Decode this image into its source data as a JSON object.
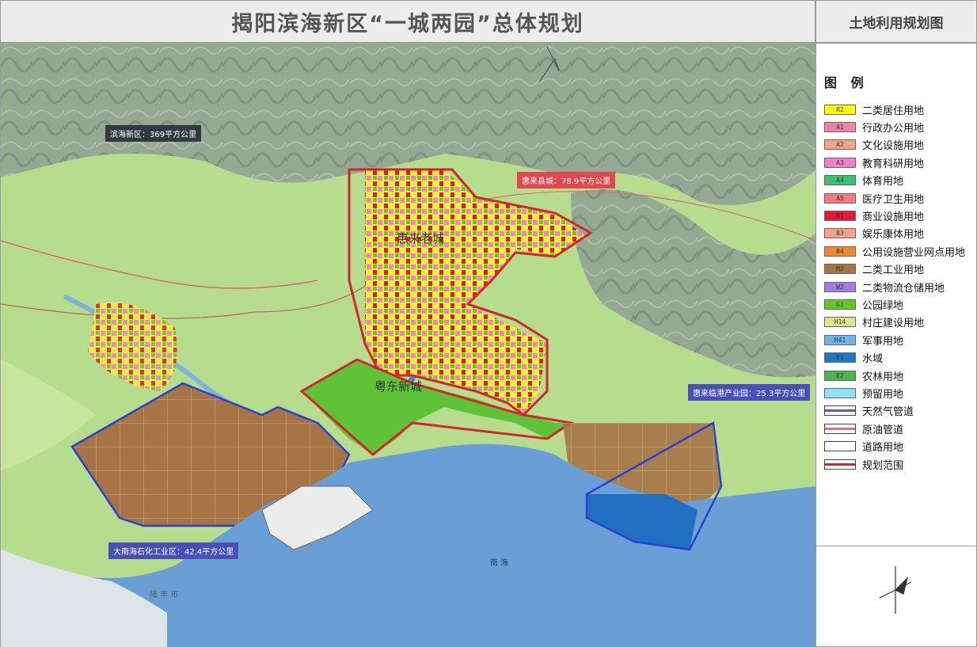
{
  "header": {
    "title": "揭阳滨海新区“一城两园”总体规划",
    "side_title": "土地利用规划图"
  },
  "map": {
    "labels": {
      "binhai": "滨海新区：369平方公里",
      "huilai_county": "惠来县城：78.9平方公里",
      "huilai_port": "惠来临港产业园：25.3平方公里",
      "dananhai": "大南海石化工业区：42.4平方公里"
    },
    "places": {
      "old_city": "惠来老城",
      "new_city": "粤东新城",
      "south_sea": "南 海",
      "lufeng": "陆 丰 市"
    },
    "colors": {
      "sea": "#6a9fd6",
      "forest": "#8ea48d",
      "farmland": "#a9d77c",
      "residential": "#ffff3a",
      "industrial": "#a67445",
      "boundary": "#d3262b"
    }
  },
  "legend": {
    "title": "图 例",
    "items": [
      {
        "code": "R2",
        "label": "二类居住用地",
        "color": "#ffff00"
      },
      {
        "code": "A1",
        "label": "行政办公用地",
        "color": "#ee82a8"
      },
      {
        "code": "A2",
        "label": "文化设施用地",
        "color": "#f7a38a"
      },
      {
        "code": "A3",
        "label": "教育科研用地",
        "color": "#f07fd0"
      },
      {
        "code": "A4",
        "label": "体育用地",
        "color": "#36c36a"
      },
      {
        "code": "A5",
        "label": "医疗卫生用地",
        "color": "#f57a7f"
      },
      {
        "code": "B1",
        "label": "商业设施用地",
        "color": "#e8163c"
      },
      {
        "code": "B3",
        "label": "娱乐康体用地",
        "color": "#f7a08a"
      },
      {
        "code": "B4",
        "label": "公用设施营业网点用地",
        "color": "#f0882f"
      },
      {
        "code": "M2",
        "label": "二类工业用地",
        "color": "#a67445"
      },
      {
        "code": "W2",
        "label": "二类物流仓储用地",
        "color": "#a07be8"
      },
      {
        "code": "G1",
        "label": "公园绿地",
        "color": "#66c81f"
      },
      {
        "code": "H14",
        "label": "村庄建设用地",
        "color": "#e0e28a"
      },
      {
        "code": "H41",
        "label": "军事用地",
        "color": "#6ab6ec"
      },
      {
        "code": "E1",
        "label": "水域",
        "color": "#1f79c8"
      },
      {
        "code": "E2",
        "label": "农林用地",
        "color": "#4cb54a"
      },
      {
        "code": "",
        "label": "预留用地",
        "color": "#8fe3f5"
      },
      {
        "code": "",
        "label": "天然气管道",
        "color": "#7a4fa0",
        "line": true
      },
      {
        "code": "",
        "label": "原油管道",
        "color": "#d9747a",
        "line": true
      },
      {
        "code": "",
        "label": "道路用地",
        "color": "#ffffff",
        "line": true
      },
      {
        "code": "",
        "label": "规划范围",
        "color": "#d3262b",
        "line": true
      }
    ]
  }
}
